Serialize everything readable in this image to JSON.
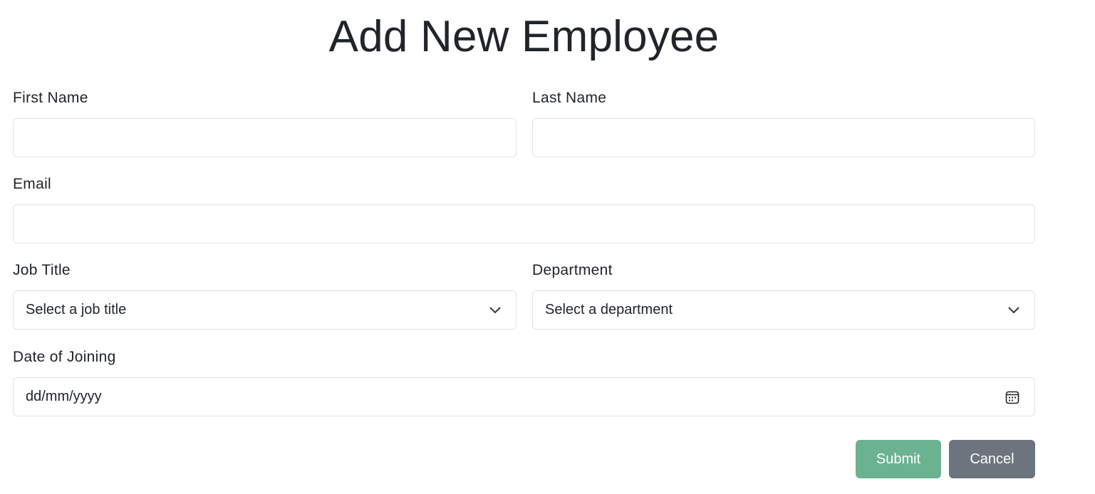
{
  "form": {
    "title": "Add New Employee",
    "first_name": {
      "label": "First Name",
      "value": ""
    },
    "last_name": {
      "label": "Last Name",
      "value": ""
    },
    "email": {
      "label": "Email",
      "value": ""
    },
    "job_title": {
      "label": "Job Title",
      "selected": "Select a job title"
    },
    "department": {
      "label": "Department",
      "selected": "Select a department"
    },
    "date_of_joining": {
      "label": "Date of Joining",
      "placeholder": "dd/mm/yyyy"
    },
    "submit_label": "Submit",
    "cancel_label": "Cancel"
  },
  "colors": {
    "submit": "#6bb390",
    "cancel": "#6c757d",
    "border": "#dee2e6",
    "text": "#212529"
  },
  "icons": {
    "select": "chevron-down-icon",
    "date": "calendar-icon"
  }
}
